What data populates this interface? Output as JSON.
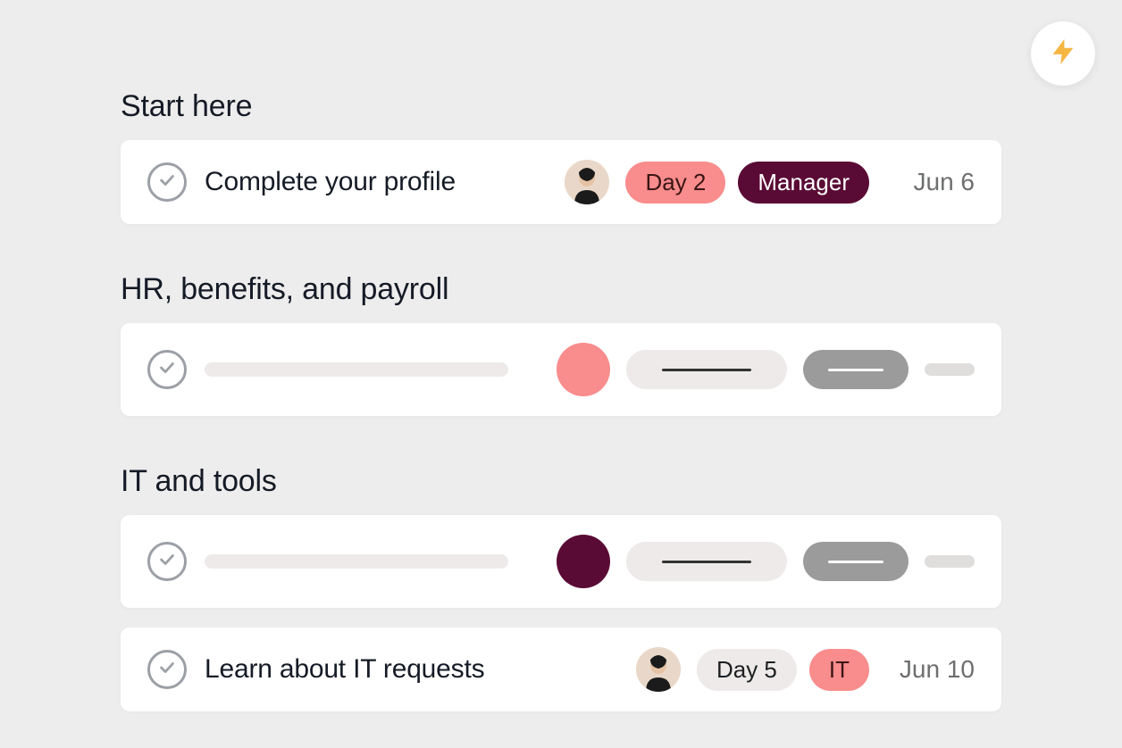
{
  "fab": {
    "icon": "lightning-icon"
  },
  "sections": [
    {
      "title": "Start here",
      "tasks": [
        {
          "type": "real",
          "title": "Complete your profile",
          "avatar": "person-1",
          "pills": [
            {
              "text": "Day 2",
              "style": "coral"
            },
            {
              "text": "Manager",
              "style": "maroon"
            }
          ],
          "due": "Jun 6"
        }
      ]
    },
    {
      "title": "HR, benefits, and payroll",
      "tasks": [
        {
          "type": "placeholder",
          "circle_color": "coral"
        }
      ]
    },
    {
      "title": "IT and tools",
      "tasks": [
        {
          "type": "placeholder",
          "circle_color": "maroon"
        },
        {
          "type": "real",
          "title": "Learn about IT requests",
          "avatar": "person-1",
          "pills": [
            {
              "text": "Day 5",
              "style": "gray"
            },
            {
              "text": "IT",
              "style": "coral"
            }
          ],
          "due": "Jun 10"
        }
      ]
    }
  ],
  "colors": {
    "coral": "#f98c8c",
    "maroon": "#5a0b35",
    "gray_pill": "#edeae9"
  }
}
